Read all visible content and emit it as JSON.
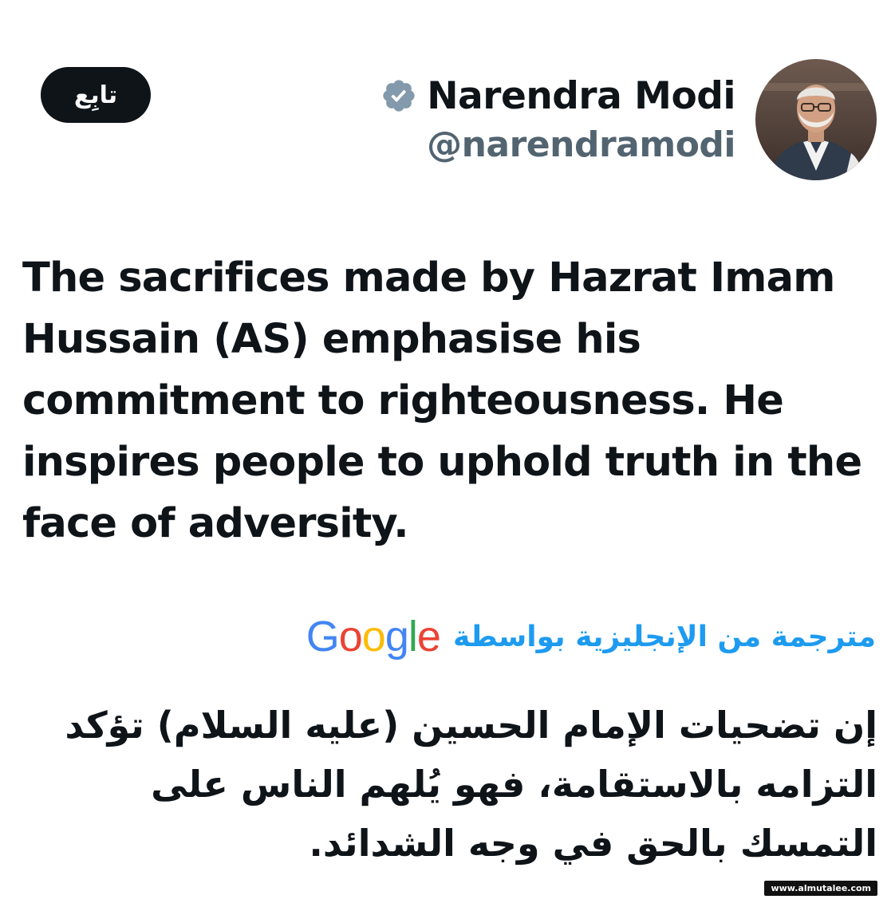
{
  "follow_button": {
    "label": "تابِع"
  },
  "author": {
    "display_name": "Narendra Modi",
    "handle": "@narendramodi",
    "verified_icon": "verified-badge-icon",
    "avatar_icon": "profile-photo"
  },
  "tweet": {
    "text": "The sacrifices made by Hazrat Imam Hussain (AS) emphasise his commitment to righteousness. He inspires people to uphold truth in the face of adversity."
  },
  "translation": {
    "label": "مترجمة من الإنجليزية بواسطة",
    "provider_letters": [
      "G",
      "o",
      "o",
      "g",
      "l",
      "e"
    ],
    "provider_colors": [
      "#4285F4",
      "#EA4335",
      "#FBBC05",
      "#4285F4",
      "#34A853",
      "#EA4335"
    ],
    "text": "إن تضحيات الإمام الحسين (عليه السلام) تؤكد التزامه بالاستقامة، فهو يُلهم الناس على التمسك بالحق في وجه الشدائد."
  },
  "watermark": {
    "text": "www.almutalee.com"
  },
  "colors": {
    "text_primary": "#0f1419",
    "text_secondary": "#536471",
    "accent": "#1d9bf0",
    "verified_badge": "#829aab"
  }
}
